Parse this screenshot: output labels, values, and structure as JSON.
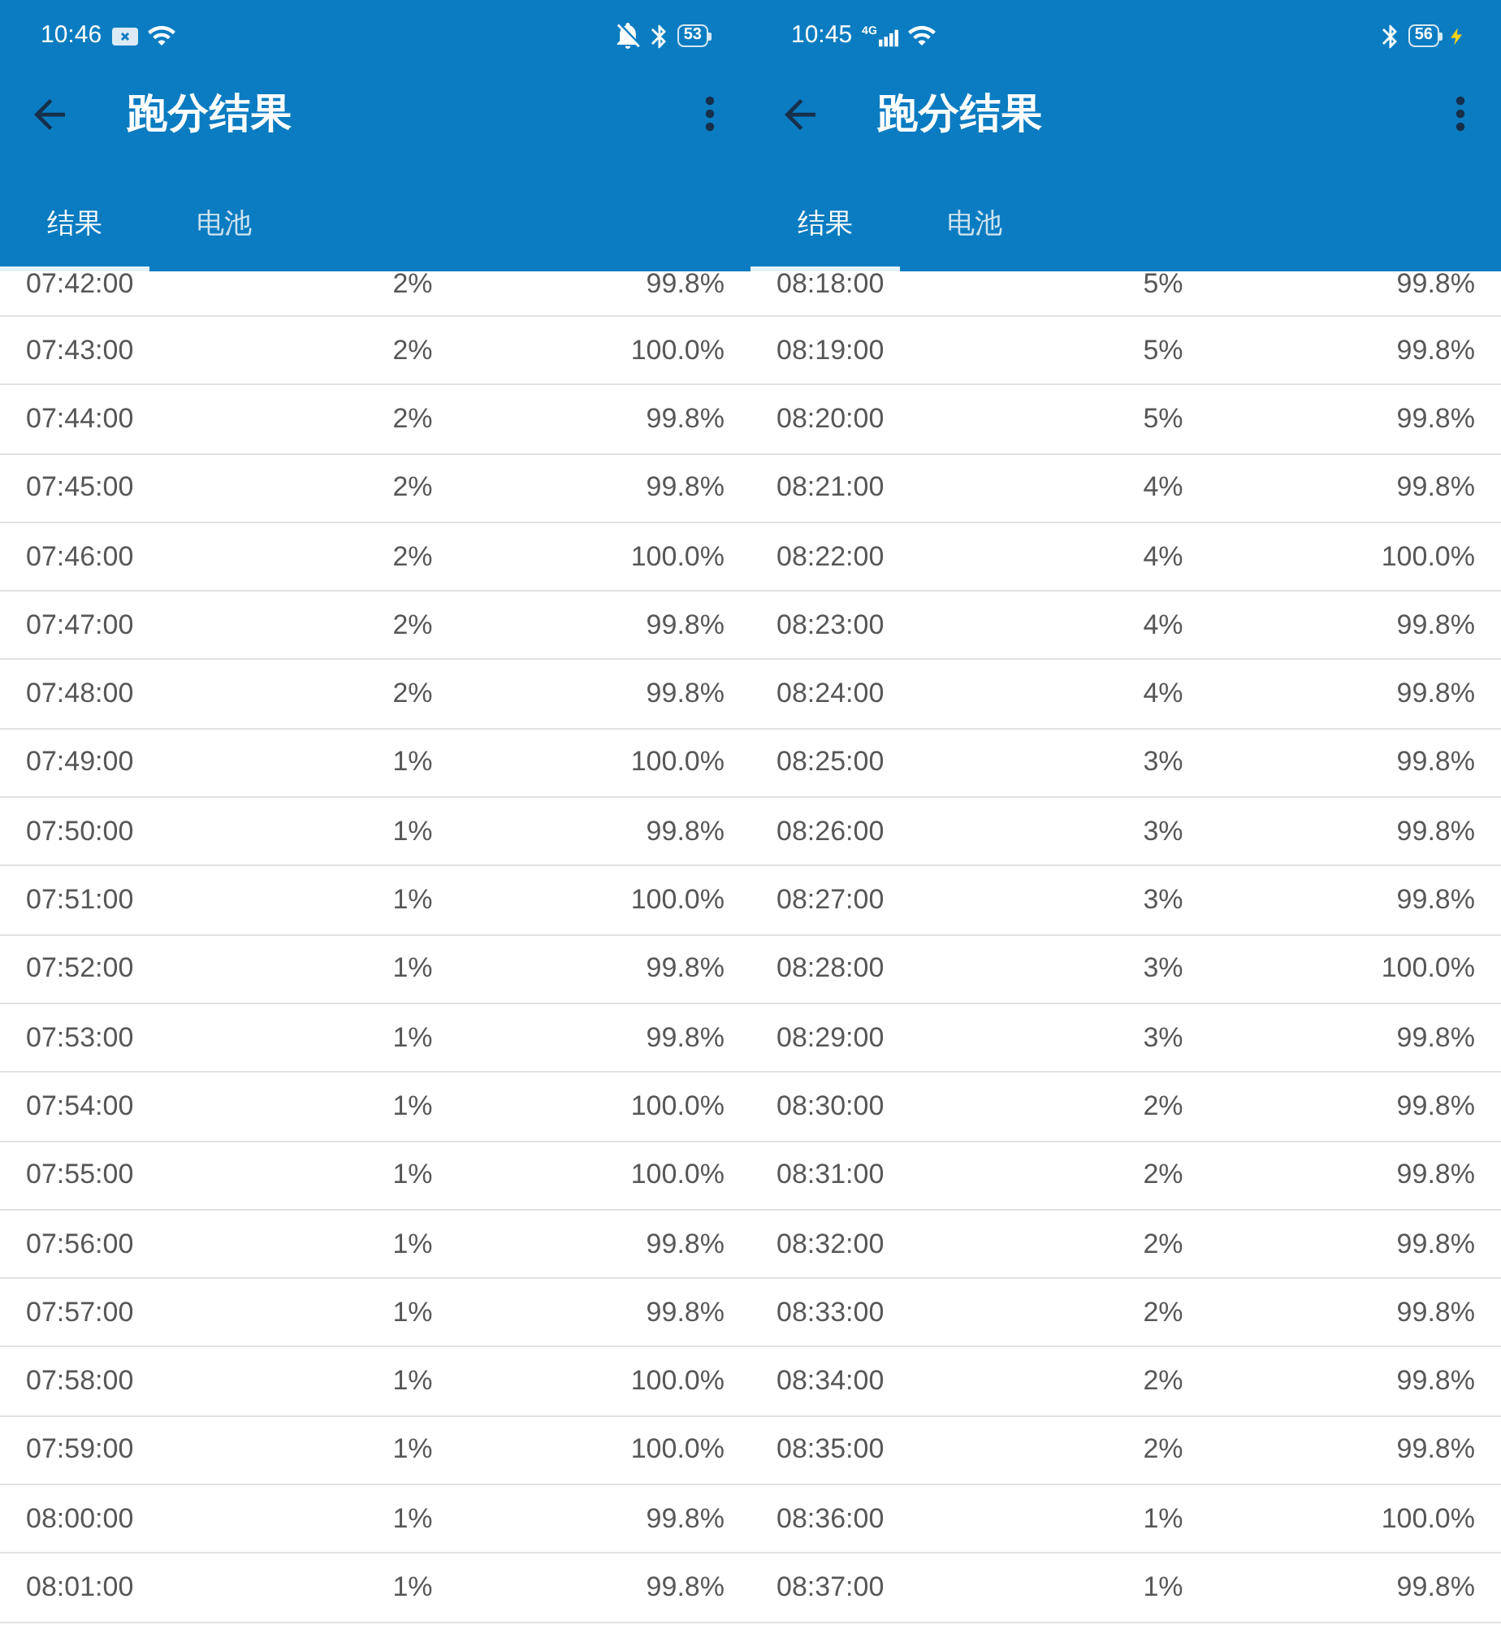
{
  "screens": [
    {
      "status_bar": {
        "time": "10:46",
        "left_icons": [
          {
            "kind": "notification"
          },
          {
            "kind": "wifi"
          }
        ],
        "right_icons": [
          {
            "kind": "mute"
          },
          {
            "kind": "bluetooth"
          },
          {
            "kind": "battery",
            "label": "53",
            "charging": false
          }
        ]
      },
      "title": "跑分结果",
      "tabs": [
        {
          "label": "结果",
          "selected": true
        },
        {
          "label": "电池",
          "selected": false
        }
      ],
      "rows": [
        [
          "07:42:00",
          "2%",
          "99.8%"
        ],
        [
          "07:43:00",
          "2%",
          "100.0%"
        ],
        [
          "07:44:00",
          "2%",
          "99.8%"
        ],
        [
          "07:45:00",
          "2%",
          "99.8%"
        ],
        [
          "07:46:00",
          "2%",
          "100.0%"
        ],
        [
          "07:47:00",
          "2%",
          "99.8%"
        ],
        [
          "07:48:00",
          "2%",
          "99.8%"
        ],
        [
          "07:49:00",
          "1%",
          "100.0%"
        ],
        [
          "07:50:00",
          "1%",
          "99.8%"
        ],
        [
          "07:51:00",
          "1%",
          "100.0%"
        ],
        [
          "07:52:00",
          "1%",
          "99.8%"
        ],
        [
          "07:53:00",
          "1%",
          "99.8%"
        ],
        [
          "07:54:00",
          "1%",
          "100.0%"
        ],
        [
          "07:55:00",
          "1%",
          "100.0%"
        ],
        [
          "07:56:00",
          "1%",
          "99.8%"
        ],
        [
          "07:57:00",
          "1%",
          "99.8%"
        ],
        [
          "07:58:00",
          "1%",
          "100.0%"
        ],
        [
          "07:59:00",
          "1%",
          "100.0%"
        ],
        [
          "08:00:00",
          "1%",
          "99.8%"
        ],
        [
          "08:01:00",
          "1%",
          "99.8%"
        ]
      ]
    },
    {
      "status_bar": {
        "time": "10:45",
        "left_icons": [
          {
            "kind": "signal",
            "label": "4G"
          },
          {
            "kind": "wifi"
          }
        ],
        "right_icons": [
          {
            "kind": "bluetooth"
          },
          {
            "kind": "battery",
            "label": "56",
            "charging": true
          }
        ]
      },
      "title": "跑分结果",
      "tabs": [
        {
          "label": "结果",
          "selected": true
        },
        {
          "label": "电池",
          "selected": false
        }
      ],
      "rows": [
        [
          "08:18:00",
          "5%",
          "99.8%"
        ],
        [
          "08:19:00",
          "5%",
          "99.8%"
        ],
        [
          "08:20:00",
          "5%",
          "99.8%"
        ],
        [
          "08:21:00",
          "4%",
          "99.8%"
        ],
        [
          "08:22:00",
          "4%",
          "100.0%"
        ],
        [
          "08:23:00",
          "4%",
          "99.8%"
        ],
        [
          "08:24:00",
          "4%",
          "99.8%"
        ],
        [
          "08:25:00",
          "3%",
          "99.8%"
        ],
        [
          "08:26:00",
          "3%",
          "99.8%"
        ],
        [
          "08:27:00",
          "3%",
          "99.8%"
        ],
        [
          "08:28:00",
          "3%",
          "100.0%"
        ],
        [
          "08:29:00",
          "3%",
          "99.8%"
        ],
        [
          "08:30:00",
          "2%",
          "99.8%"
        ],
        [
          "08:31:00",
          "2%",
          "99.8%"
        ],
        [
          "08:32:00",
          "2%",
          "99.8%"
        ],
        [
          "08:33:00",
          "2%",
          "99.8%"
        ],
        [
          "08:34:00",
          "2%",
          "99.8%"
        ],
        [
          "08:35:00",
          "2%",
          "99.8%"
        ],
        [
          "08:36:00",
          "1%",
          "100.0%"
        ],
        [
          "08:37:00",
          "1%",
          "99.8%"
        ]
      ]
    }
  ]
}
